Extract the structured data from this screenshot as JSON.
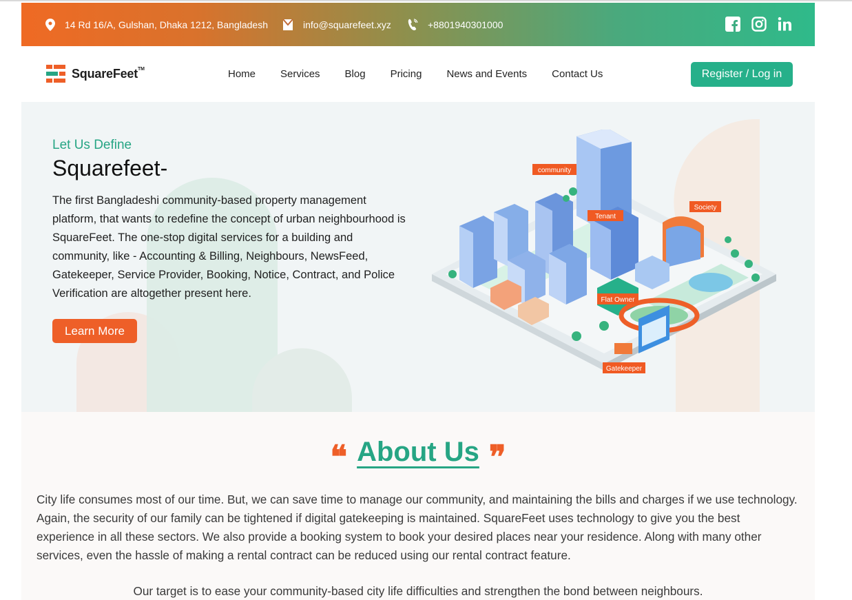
{
  "topbar": {
    "address": "14 Rd 16/A, Gulshan, Dhaka 1212, Bangladesh",
    "email": "info@squarefeet.xyz",
    "phone": "+8801940301000",
    "icons": [
      "location-pin-icon",
      "email-icon",
      "phone-icon",
      "facebook-icon",
      "instagram-icon",
      "linkedin-icon"
    ]
  },
  "brand": {
    "name": "SquareFeet",
    "tm": "TM"
  },
  "nav": {
    "items": [
      "Home",
      "Services",
      "Blog",
      "Pricing",
      "News and Events",
      "Contact Us"
    ],
    "cta": "Register / Log in"
  },
  "hero": {
    "eyebrow": "Let Us Define",
    "title": "Squarefeet-",
    "description": "The first Bangladeshi community-based property management platform, that wants to redefine the concept of urban neighbourhood is SquareFeet. The one-stop digital services for a building and community, like - Accounting & Billing, Neighbours, NewsFeed, Gatekeeper, Service Provider, Booking, Notice, Contract, and Police Verification are altogether present here.",
    "button": "Learn More",
    "illustration_labels": {
      "community": "community",
      "tenant": "Tenant",
      "society": "Society",
      "flat_owner": "Flat Owner",
      "gatekeeper": "Gatekeeper"
    }
  },
  "about": {
    "open_quote": "❝",
    "title": "About Us",
    "close_quote": "❞",
    "paragraph": "City life consumes most of our time. But, we can save time to manage our community, and maintaining the bills and charges if we use technology. Again, the security of our family can be tightened if digital gatekeeping is maintained. SquareFeet uses technology to give you the best experience in all these sectors. We also provide a booking system to book your desired places near your residence. Along with many other services, even the hassle of making a rental contract can be reduced using our rental contract feature.",
    "target": "Our target is to ease your community-based city life difficulties and strengthen the bond between neighbours."
  },
  "colors": {
    "accent_green": "#26b08a",
    "accent_orange": "#ee5f28",
    "hero_bg": "#f1f5f6"
  }
}
